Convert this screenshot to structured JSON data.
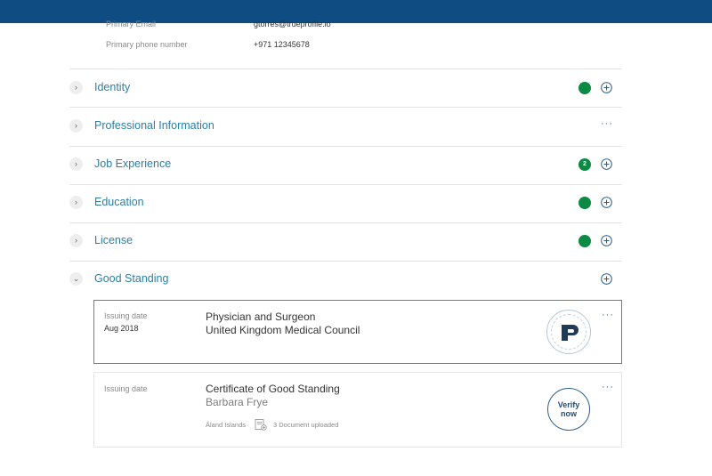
{
  "contact": {
    "email_label": "Primary Email",
    "email_value": "gtorres@trueprofile.io",
    "phone_label": "Primary phone number",
    "phone_value": "+971 12345678"
  },
  "sections": [
    {
      "title": "Identity",
      "status": "complete",
      "badge": ""
    },
    {
      "title": "Professional Information",
      "status": "none",
      "badge": ""
    },
    {
      "title": "Job Experience",
      "status": "count",
      "badge": "2"
    },
    {
      "title": "Education",
      "status": "complete",
      "badge": ""
    },
    {
      "title": "License",
      "status": "complete",
      "badge": ""
    },
    {
      "title": "Good Standing",
      "status": "none",
      "badge": ""
    }
  ],
  "good_standing": {
    "cards": [
      {
        "label": "Issuing date",
        "date": "Aug 2018",
        "title": "Physician and Surgeon",
        "subtitle": "United Kingdom Medical Council",
        "badge": "verified-seal"
      },
      {
        "label": "Issuing date",
        "title": "Certificate of Good Standing",
        "subtitle": "Barbara Frye",
        "location": "Åland Islands",
        "documents": "3 Document uploaded",
        "verify_line1": "Verify",
        "verify_line2": "now"
      }
    ]
  },
  "colors": {
    "topbar": "#0f4c81",
    "section_title": "#2c7fa4",
    "status_green": "#0a8a43",
    "accent_dark": "#2c5f8a"
  },
  "icons": {
    "expand": "chevron-right-icon",
    "collapse": "chevron-down-icon",
    "add": "plus-circle-icon",
    "more": "ellipsis-icon",
    "document": "document-icon",
    "seal": "trueprofile-seal-icon"
  }
}
